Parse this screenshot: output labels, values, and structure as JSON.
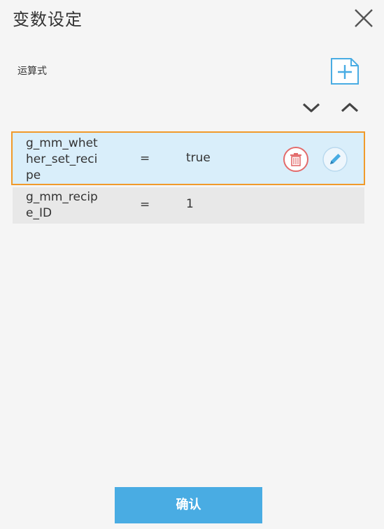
{
  "header": {
    "title": "变数设定",
    "close_icon": "close-icon"
  },
  "section": {
    "label": "运算式"
  },
  "toolbar": {
    "add_icon": "add-document-icon",
    "move_down_icon": "chevron-down-icon",
    "move_up_icon": "chevron-up-icon"
  },
  "expressions": [
    {
      "name": "g_mm_whether_set_recipe",
      "operator": "=",
      "value": "true",
      "selected": true
    },
    {
      "name": "g_mm_recipe_ID",
      "operator": "=",
      "value": "1",
      "selected": false
    }
  ],
  "row_actions": {
    "delete_icon": "trash-icon",
    "edit_icon": "pencil-icon"
  },
  "footer": {
    "confirm_label": "确认"
  },
  "colors": {
    "accent": "#49ace3",
    "selected_border": "#f09a2a",
    "selected_bg": "#d9eefa",
    "delete_red": "#e36b6b"
  }
}
